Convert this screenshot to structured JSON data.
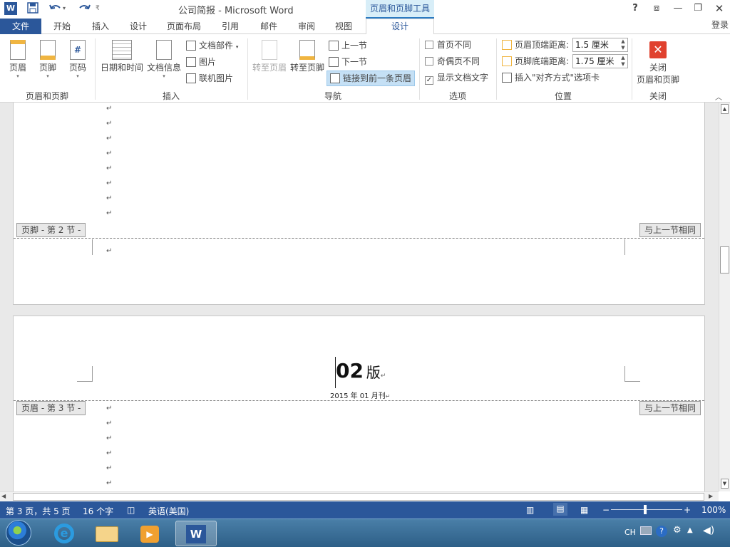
{
  "titlebar": {
    "title": "公司简报 - Microsoft Word",
    "context_tab": "页眉和页脚工具",
    "help": "?",
    "login": "登录"
  },
  "tabs": {
    "file": "文件",
    "home": "开始",
    "insert": "插入",
    "design_doc": "设计",
    "layout": "页面布局",
    "references": "引用",
    "mailings": "邮件",
    "review": "审阅",
    "view": "视图",
    "design": "设计"
  },
  "ribbon": {
    "group_header_footer": {
      "label": "页眉和页脚",
      "header": "页眉",
      "footer": "页脚",
      "page_number": "页码"
    },
    "group_insert": {
      "label": "插入",
      "date_time": "日期和时间",
      "doc_info": "文档信息",
      "quick_parts": "文档部件",
      "pictures": "图片",
      "online_pictures": "联机图片"
    },
    "group_navigation": {
      "label": "导航",
      "goto_header": "转至页眉",
      "goto_footer": "转至页脚",
      "previous": "上一节",
      "next": "下一节",
      "link_previous": "链接到前一条页眉"
    },
    "group_options": {
      "label": "选项",
      "different_first": "首页不同",
      "different_odd_even": "奇偶页不同",
      "show_doc_text": "显示文档文字",
      "different_first_checked": false,
      "different_odd_even_checked": false,
      "show_doc_text_checked": true
    },
    "group_position": {
      "label": "位置",
      "header_top": "页眉顶端距离:",
      "header_top_value": "1.5 厘米",
      "footer_bottom": "页脚底端距离:",
      "footer_bottom_value": "1.75 厘米",
      "insert_align_tab": "插入\"对齐方式\"选项卡"
    },
    "group_close": {
      "label": "关闭",
      "close_line1": "关闭",
      "close_line2": "页眉和页脚"
    }
  },
  "document": {
    "footer_tag": "页脚 - 第 2 节 -",
    "same_as_prev_1": "与上一节相同",
    "header_tag": "页眉 - 第 3 节 -",
    "same_as_prev_2": "与上一节相同",
    "header_title_num": "02",
    "header_title_word": "版",
    "header_date": "2015 年 01 月刊",
    "para_mark": "↵"
  },
  "statusbar": {
    "page": "第 3 页，共 5 页",
    "words": "16 个字",
    "language": "英语(美国)",
    "zoom": "100%"
  },
  "taskbar": {
    "ime": "CH"
  },
  "colors": {
    "accent": "#2b579a",
    "context_tab_bg": "#d8eef8",
    "close_red": "#e0412e"
  }
}
